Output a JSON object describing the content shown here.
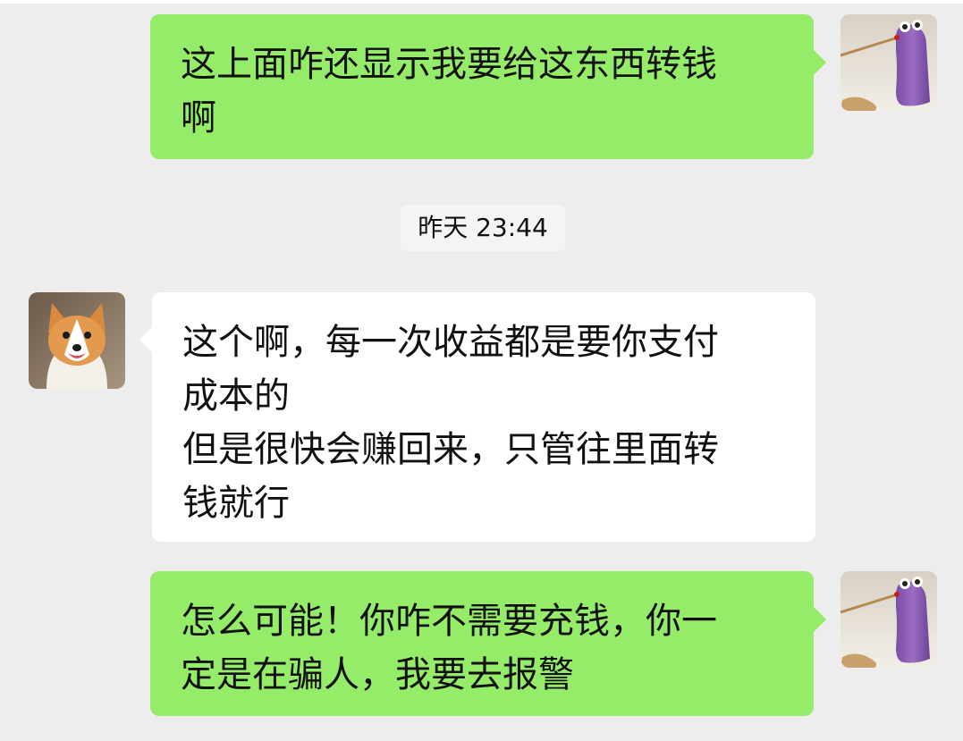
{
  "messages": [
    {
      "sender": "self",
      "avatar": "purple-figure-avatar",
      "lines": [
        "这上面咋还显示我要给这东西转钱",
        "啊"
      ]
    },
    {
      "sender": "other",
      "avatar": "corgi-dog-avatar",
      "lines": [
        "这个啊，每一次收益都是要你支付",
        "成本的",
        "但是很快会赚回来，只管往里面转",
        "钱就行"
      ]
    },
    {
      "sender": "self",
      "avatar": "purple-figure-avatar",
      "lines": [
        "怎么可能！你咋不需要充钱，你一",
        "定是在骗人，我要去报警"
      ]
    }
  ],
  "timestamp": "昨天 23:44",
  "colors": {
    "background": "#ededed",
    "self_bubble": "#95ec69",
    "other_bubble": "#ffffff"
  }
}
